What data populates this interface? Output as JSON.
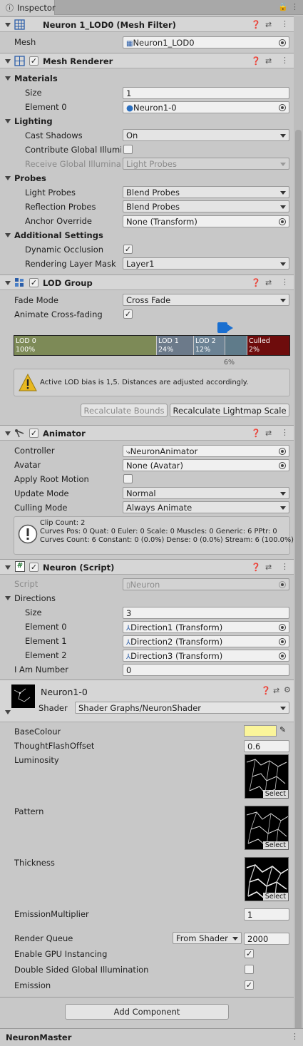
{
  "tab": {
    "label": "Inspector"
  },
  "mesh_filter": {
    "title": "Neuron 1_LOD0 (Mesh Filter)",
    "mesh_label": "Mesh",
    "mesh_value": "Neuron1_LOD0"
  },
  "mesh_renderer": {
    "title": "Mesh Renderer",
    "materials": "Materials",
    "size_label": "Size",
    "size_value": "1",
    "element0_label": "Element 0",
    "element0_value": "Neuron1-0",
    "lighting": "Lighting",
    "cast_label": "Cast Shadows",
    "cast_value": "On",
    "contrib_label": "Contribute Global Illumin",
    "receive_label": "Receive Global Illuminat",
    "receive_value": "Light Probes",
    "probes": "Probes",
    "light_probes_label": "Light Probes",
    "light_probes_value": "Blend Probes",
    "refl_label": "Reflection Probes",
    "refl_value": "Blend Probes",
    "anchor_label": "Anchor Override",
    "anchor_value": "None (Transform)",
    "additional": "Additional Settings",
    "dyn_label": "Dynamic Occlusion",
    "rlm_label": "Rendering Layer Mask",
    "rlm_value": "Layer1"
  },
  "lod_group": {
    "title": "LOD Group",
    "fade_label": "Fade Mode",
    "fade_value": "Cross Fade",
    "anim_label": "Animate Cross-fading",
    "lods": [
      {
        "name": "LOD 0",
        "pct": "100%",
        "color": "#7d8a57"
      },
      {
        "name": "LOD 1",
        "pct": "24%",
        "color": "#6c7a8a"
      },
      {
        "name": "LOD 2",
        "pct": "12%",
        "color": "#6b8294"
      },
      {
        "name": "",
        "pct": "",
        "color": "#5f7b8a"
      },
      {
        "name": "Culled",
        "pct": "2%",
        "color": "#6e0c0c"
      }
    ],
    "camera_pct": "6%",
    "warning": "Active LOD bias is 1,5. Distances are adjusted accordingly.",
    "recalc_bounds": "Recalculate Bounds",
    "recalc_lightmap": "Recalculate Lightmap Scale"
  },
  "animator": {
    "title": "Animator",
    "controller_label": "Controller",
    "controller_value": "NeuronAnimator",
    "avatar_label": "Avatar",
    "avatar_value": "None (Avatar)",
    "root_label": "Apply Root Motion",
    "update_label": "Update Mode",
    "update_value": "Normal",
    "culling_label": "Culling Mode",
    "culling_value": "Always Animate",
    "info1": "Clip Count: 2",
    "info2": "Curves Pos: 0 Quat: 0 Euler: 0 Scale: 0 Muscles: 0 Generic: 6 PPtr: 0",
    "info3": "Curves Count: 6 Constant: 0 (0.0%) Dense: 0 (0.0%) Stream: 6 (100.0%)"
  },
  "neuron_script": {
    "title": "Neuron (Script)",
    "script_label": "Script",
    "script_value": "Neuron",
    "directions": "Directions",
    "size_label": "Size",
    "size_value": "3",
    "e0_label": "Element 0",
    "e0_value": "Direction1 (Transform)",
    "e1_label": "Element 1",
    "e1_value": "Direction2 (Transform)",
    "e2_label": "Element 2",
    "e2_value": "Direction3 (Transform)",
    "num_label": "I Am Number",
    "num_value": "0"
  },
  "material": {
    "title": "Neuron1-0",
    "shader_label": "Shader",
    "shader_value": "Shader Graphs/NeuronShader",
    "base_label": "BaseColour",
    "base_color": "#fbf59a",
    "thought_label": "ThoughtFlashOffset",
    "thought_value": "0.6",
    "lum_label": "Luminosity",
    "pattern_label": "Pattern",
    "thick_label": "Thickness",
    "select": "Select",
    "emis_mult_label": "EmissionMultiplier",
    "emis_mult_value": "1",
    "rq_label": "Render Queue",
    "rq_mode": "From Shader",
    "rq_value": "2000",
    "gpu_label": "Enable GPU Instancing",
    "dsgi_label": "Double Sided Global Illumination",
    "emission_label": "Emission"
  },
  "add_component": "Add Component",
  "footer": {
    "label": "NeuronMaster"
  }
}
